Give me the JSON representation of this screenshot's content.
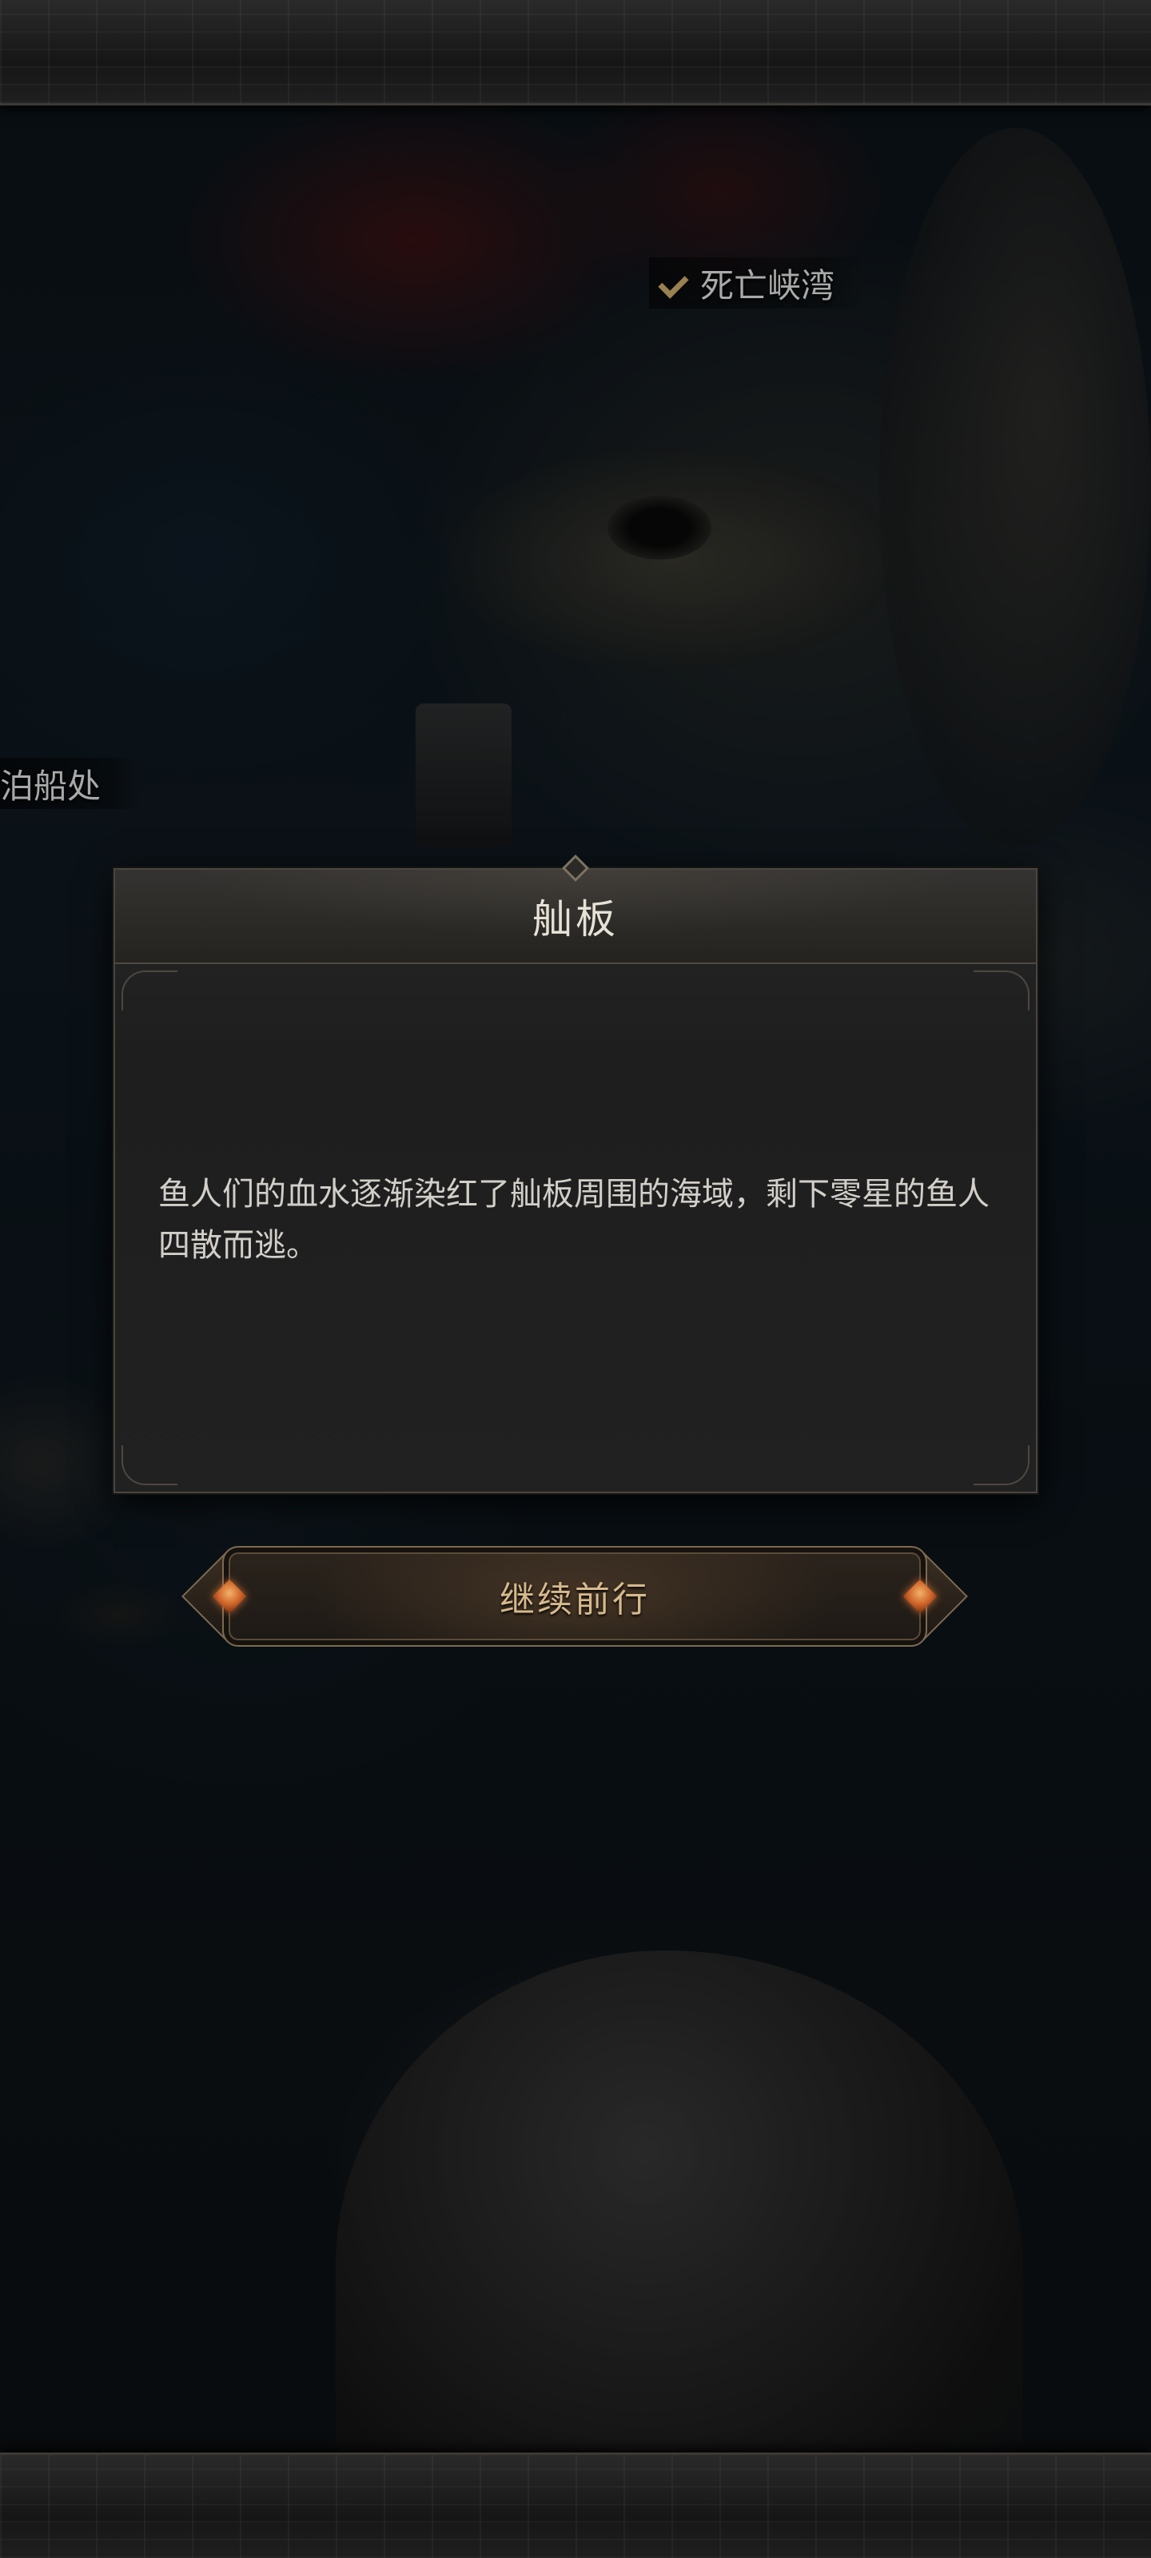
{
  "map": {
    "labels": [
      {
        "text": "死亡峡湾",
        "visited": true
      },
      {
        "text": "泊船处",
        "visited": false
      }
    ]
  },
  "dialog": {
    "title": "舢板",
    "body": "鱼人们的血水逐渐染红了舢板周围的海域，剩下零星的鱼人四散而逃。"
  },
  "actions": {
    "continue_label": "继续前行"
  },
  "colors": {
    "accent_gold": "#d6b98c",
    "gem_orange": "#d0662a",
    "panel_bg": "#1e1e1e",
    "title_text": "#e6e1d6"
  },
  "icons": {
    "visited_marker": "check-icon",
    "button_ornament": "gem-icon"
  }
}
